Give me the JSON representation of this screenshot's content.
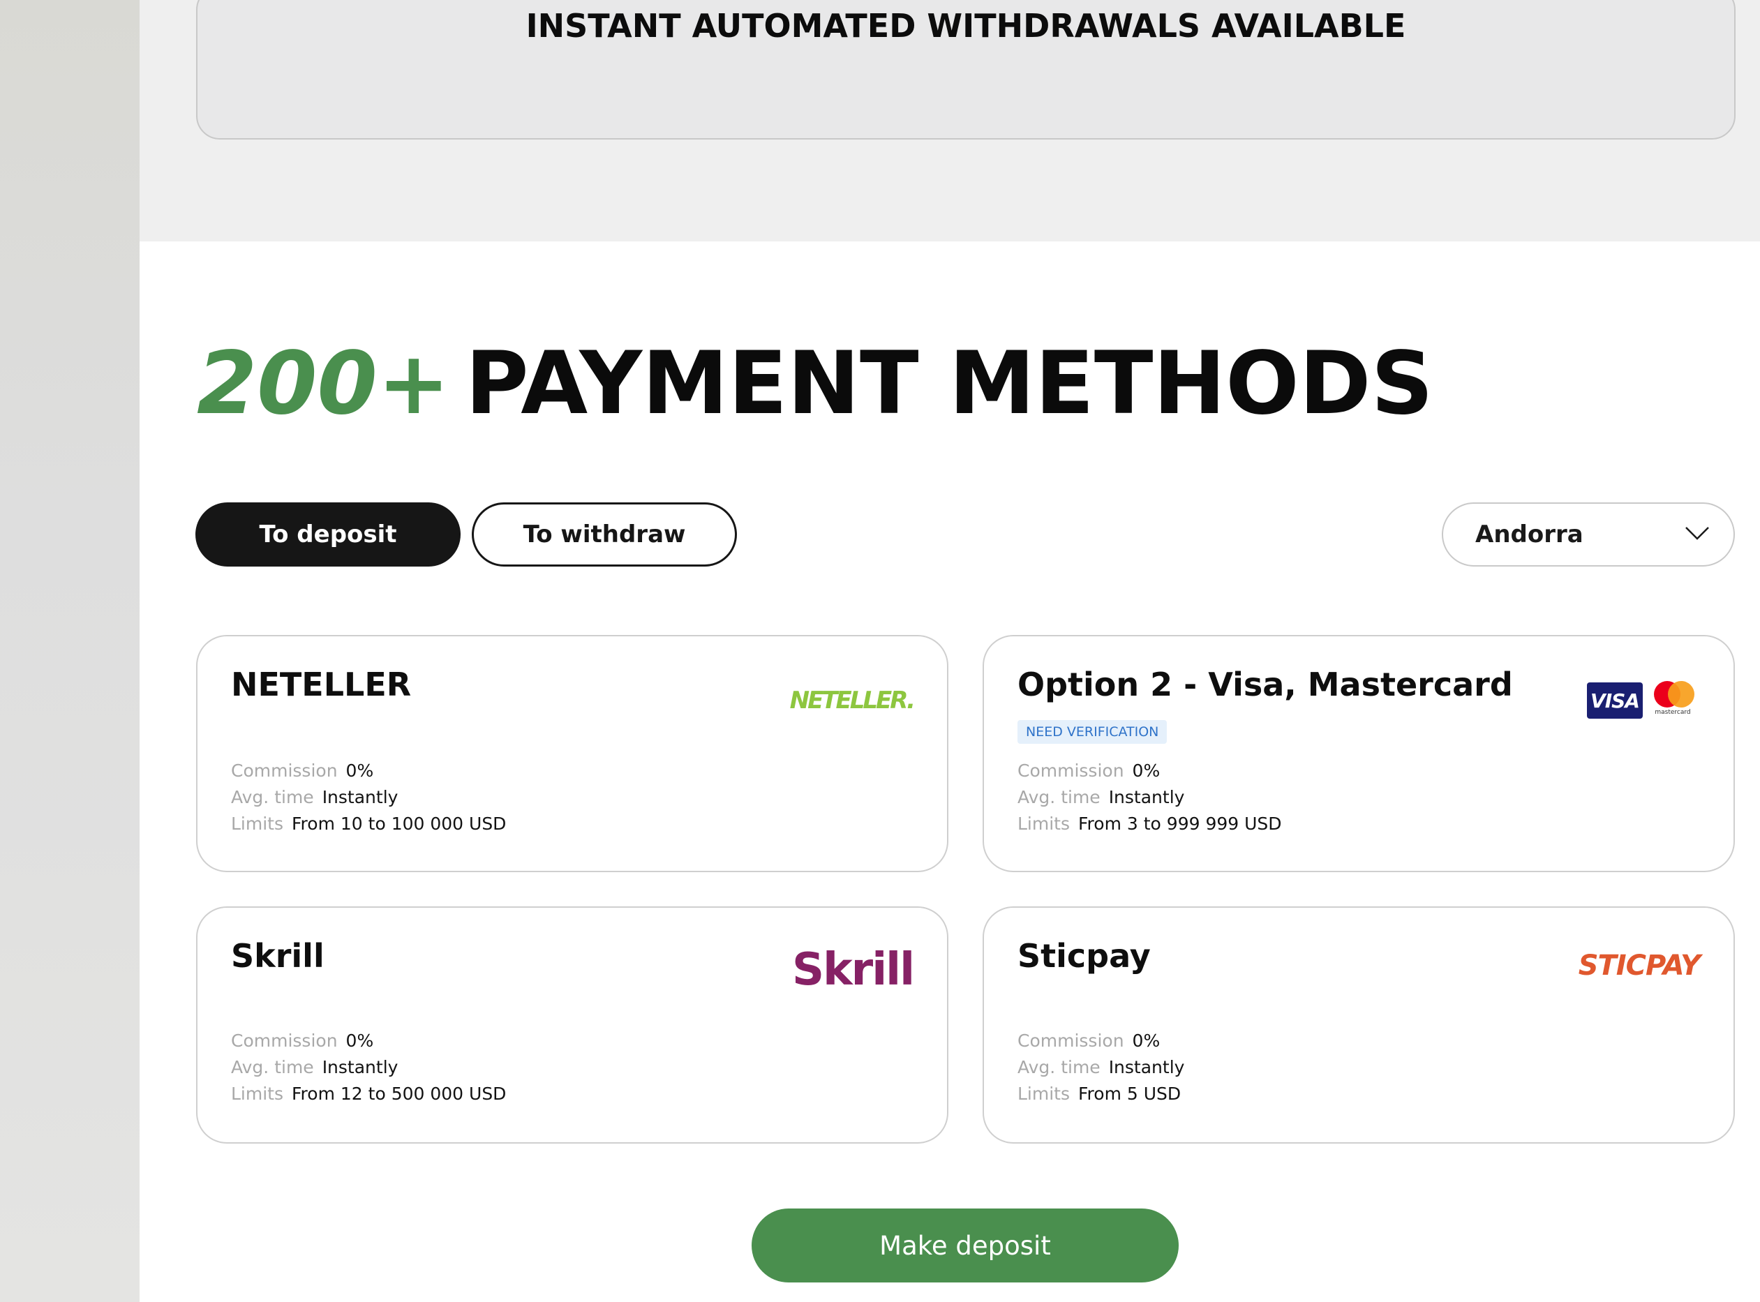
{
  "banner": {
    "text": "INSTANT AUTOMATED WITHDRAWALS AVAILABLE"
  },
  "headline": {
    "accent": "200+",
    "rest": "PAYMENT METHODS",
    "accent_color": "#4a8f4e"
  },
  "tabs": [
    {
      "label": "To deposit",
      "active": true
    },
    {
      "label": "To withdraw",
      "active": false
    }
  ],
  "country_select": {
    "value": "Andorra",
    "icon": "chevron-down-icon"
  },
  "labels": {
    "commission": "Commission",
    "avg_time": "Avg. time",
    "limits": "Limits"
  },
  "methods": [
    {
      "title": "NETELLER",
      "logo_text": "NETELLER.",
      "commission": "0%",
      "avg_time": "Instantly",
      "limits": "From 10 to 100 000 USD"
    },
    {
      "title": "Option 2 - Visa, Mastercard",
      "badge": "NEED VERIFICATION",
      "logo_visa": "VISA",
      "logo_mc": "mastercard",
      "commission": "0%",
      "avg_time": "Instantly",
      "limits": "From 3 to 999 999 USD"
    },
    {
      "title": "Skrill",
      "logo_text": "Skrill",
      "commission": "0%",
      "avg_time": "Instantly",
      "limits": "From 12 to 500 000 USD"
    },
    {
      "title": "Sticpay",
      "logo_text": "STICPAY",
      "commission": "0%",
      "avg_time": "Instantly",
      "limits": "From 5 USD"
    }
  ],
  "deposit_button": {
    "label": "Make deposit",
    "color": "#4a8f4e"
  }
}
